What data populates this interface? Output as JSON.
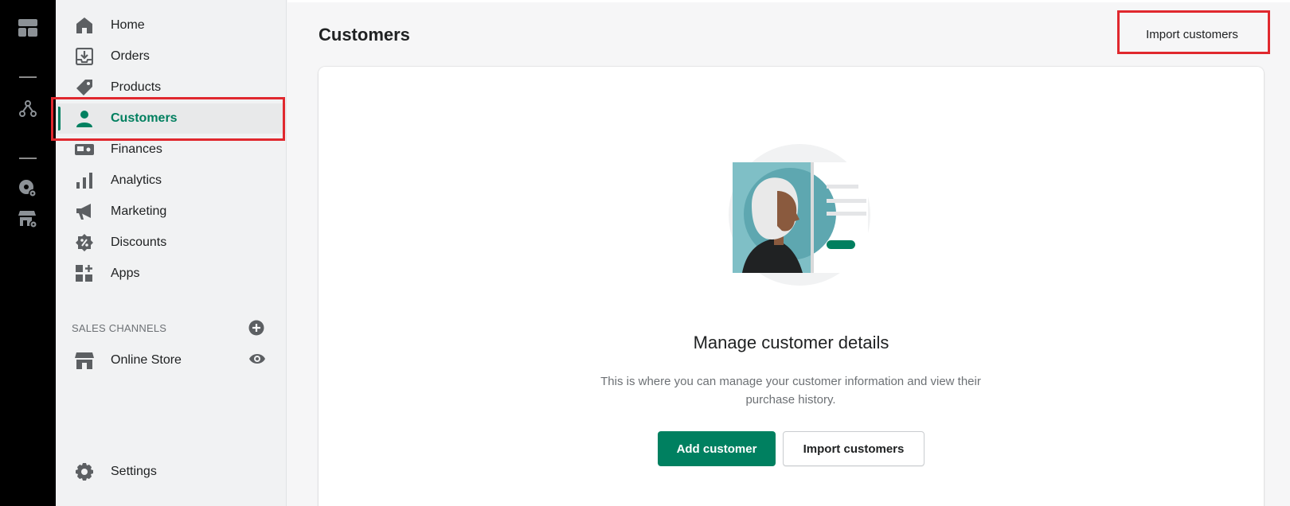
{
  "rail": {
    "icons": [
      "layout-grid-icon",
      "nodes-icon",
      "globe-settings-icon",
      "store-settings-icon"
    ]
  },
  "sidebar": {
    "items": [
      {
        "label": "Home",
        "icon": "home-icon"
      },
      {
        "label": "Orders",
        "icon": "orders-icon"
      },
      {
        "label": "Products",
        "icon": "tag-icon"
      },
      {
        "label": "Customers",
        "icon": "person-icon",
        "active": true
      },
      {
        "label": "Finances",
        "icon": "finances-icon"
      },
      {
        "label": "Analytics",
        "icon": "bar-chart-icon"
      },
      {
        "label": "Marketing",
        "icon": "megaphone-icon"
      },
      {
        "label": "Discounts",
        "icon": "discount-icon"
      },
      {
        "label": "Apps",
        "icon": "apps-icon"
      }
    ],
    "sales_channels_heading": "SALES CHANNELS",
    "online_store": {
      "label": "Online Store",
      "icon": "store-icon"
    },
    "settings": {
      "label": "Settings",
      "icon": "gear-icon"
    }
  },
  "header": {
    "title": "Customers",
    "import_label": "Import customers"
  },
  "empty_state": {
    "heading": "Manage customer details",
    "text": "This is where you can manage your customer information and view their purchase history.",
    "add_label": "Add customer",
    "import_label": "Import customers"
  },
  "colors": {
    "accent": "#008060",
    "highlight": "#e0282e",
    "rail": "#000000"
  }
}
